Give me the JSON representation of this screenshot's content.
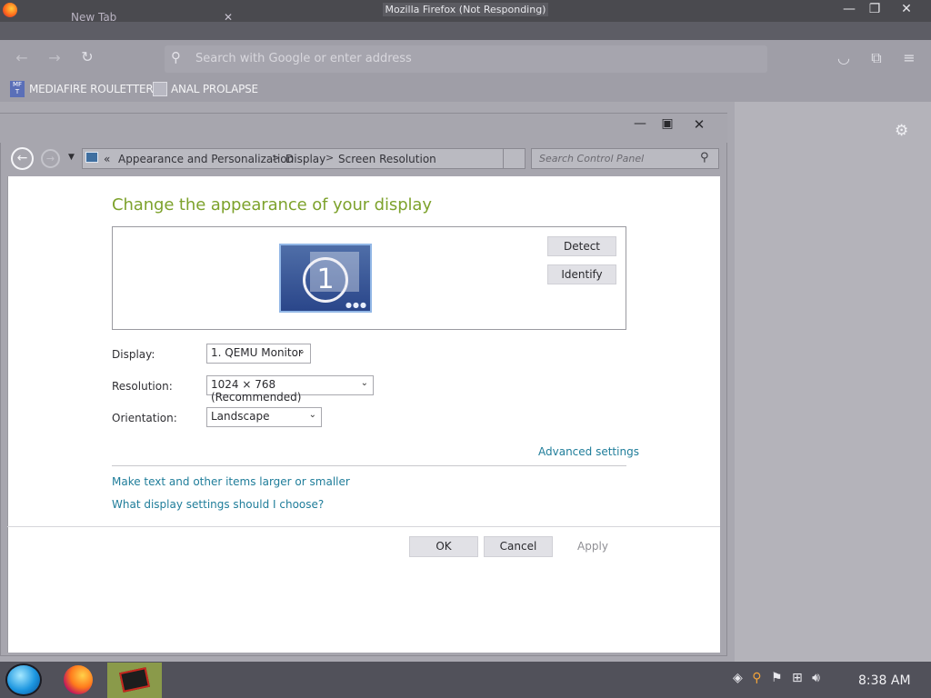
{
  "firefox": {
    "window_title": "Mozilla Firefox (Not Responding)",
    "tab_title": "New Tab",
    "url_placeholder": "Search with Google or enter address",
    "bookmarks": [
      {
        "label": "MEDIAFIRE ROULETTER",
        "icon_text": "MF T"
      },
      {
        "label": "ANAL PROLAPSE"
      }
    ]
  },
  "control_panel": {
    "breadcrumbs": [
      "Appearance and Personalization",
      "Display",
      "Screen Resolution"
    ],
    "breadcrumb_prefix": "«",
    "search_placeholder": "Search Control Panel",
    "heading": "Change the appearance of your display",
    "monitor_number": "1",
    "detect_label": "Detect",
    "identify_label": "Identify",
    "display": {
      "label": "Display:",
      "value": "1. QEMU Monitor"
    },
    "resolution": {
      "label": "Resolution:",
      "value": "1024 × 768 (Recommended)"
    },
    "orientation": {
      "label": "Orientation:",
      "value": "Landscape"
    },
    "advanced_link": "Advanced settings",
    "link_larger": "Make text and other items larger or smaller",
    "link_help": "What display settings should I choose?",
    "ok_label": "OK",
    "cancel_label": "Cancel",
    "apply_label": "Apply"
  },
  "taskbar": {
    "clock": "8:38 AM"
  },
  "colors": {
    "heading_green": "#7da22c",
    "link_blue": "#1f7d9a",
    "taskbar": "#51515a"
  }
}
